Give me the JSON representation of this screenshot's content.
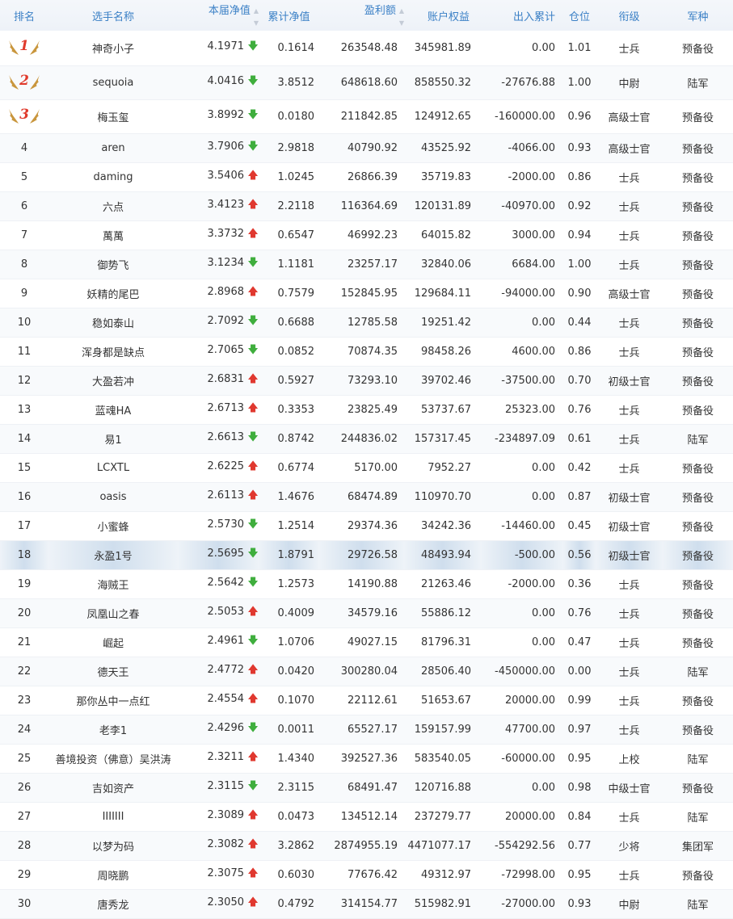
{
  "colors": {
    "header_text": "#3b80c6",
    "up": "#e0382f",
    "down": "#3fae3d",
    "medal_number": "#e03a2c",
    "medal_wing": "#c9963d"
  },
  "headers": {
    "rank": "排名",
    "name": "选手名称",
    "nav": "本届净值",
    "cum_nav": "累计净值",
    "profit": "盈利额",
    "equity": "账户权益",
    "flow": "出入累计",
    "position": "仓位",
    "title": "衔级",
    "army": "军种"
  },
  "icons": {
    "sort": "sort-icon",
    "up": "arrow-up-icon",
    "down": "arrow-down-icon",
    "medal": "winged-medal-icon"
  },
  "rows": [
    {
      "rank": "1",
      "medal": true,
      "name": "神奇小子",
      "nav": "4.1971",
      "trend": "down",
      "cum": "0.1614",
      "profit": "263548.48",
      "equity": "345981.89",
      "flow": "0.00",
      "pos": "1.01",
      "title": "士兵",
      "army": "预备役"
    },
    {
      "rank": "2",
      "medal": true,
      "name": "sequoia",
      "nav": "4.0416",
      "trend": "down",
      "cum": "3.8512",
      "profit": "648618.60",
      "equity": "858550.32",
      "flow": "-27676.88",
      "pos": "1.00",
      "title": "中尉",
      "army": "陆军"
    },
    {
      "rank": "3",
      "medal": true,
      "name": "梅玉玺",
      "nav": "3.8992",
      "trend": "down",
      "cum": "0.0180",
      "profit": "211842.85",
      "equity": "124912.65",
      "flow": "-160000.00",
      "pos": "0.96",
      "title": "高级士官",
      "army": "预备役"
    },
    {
      "rank": "4",
      "name": "aren",
      "nav": "3.7906",
      "trend": "down",
      "cum": "2.9818",
      "profit": "40790.92",
      "equity": "43525.92",
      "flow": "-4066.00",
      "pos": "0.93",
      "title": "高级士官",
      "army": "预备役"
    },
    {
      "rank": "5",
      "name": "daming",
      "nav": "3.5406",
      "trend": "up",
      "cum": "1.0245",
      "profit": "26866.39",
      "equity": "35719.83",
      "flow": "-2000.00",
      "pos": "0.86",
      "title": "士兵",
      "army": "预备役"
    },
    {
      "rank": "6",
      "name": "六点",
      "nav": "3.4123",
      "trend": "up",
      "cum": "2.2118",
      "profit": "116364.69",
      "equity": "120131.89",
      "flow": "-40970.00",
      "pos": "0.92",
      "title": "士兵",
      "army": "预备役"
    },
    {
      "rank": "7",
      "name": "萬萬",
      "nav": "3.3732",
      "trend": "up",
      "cum": "0.6547",
      "profit": "46992.23",
      "equity": "64015.82",
      "flow": "3000.00",
      "pos": "0.94",
      "title": "士兵",
      "army": "预备役"
    },
    {
      "rank": "8",
      "name": "御势飞",
      "nav": "3.1234",
      "trend": "down",
      "cum": "1.1181",
      "profit": "23257.17",
      "equity": "32840.06",
      "flow": "6684.00",
      "pos": "1.00",
      "title": "士兵",
      "army": "预备役"
    },
    {
      "rank": "9",
      "name": "妖精的尾巴",
      "nav": "2.8968",
      "trend": "up",
      "cum": "0.7579",
      "profit": "152845.95",
      "equity": "129684.11",
      "flow": "-94000.00",
      "pos": "0.90",
      "title": "高级士官",
      "army": "预备役"
    },
    {
      "rank": "10",
      "name": "稳如泰山",
      "nav": "2.7092",
      "trend": "down",
      "cum": "0.6688",
      "profit": "12785.58",
      "equity": "19251.42",
      "flow": "0.00",
      "pos": "0.44",
      "title": "士兵",
      "army": "预备役"
    },
    {
      "rank": "11",
      "name": "浑身都是缺点",
      "nav": "2.7065",
      "trend": "down",
      "cum": "0.0852",
      "profit": "70874.35",
      "equity": "98458.26",
      "flow": "4600.00",
      "pos": "0.86",
      "title": "士兵",
      "army": "预备役"
    },
    {
      "rank": "12",
      "name": "大盈若冲",
      "nav": "2.6831",
      "trend": "up",
      "cum": "0.5927",
      "profit": "73293.10",
      "equity": "39702.46",
      "flow": "-37500.00",
      "pos": "0.70",
      "title": "初级士官",
      "army": "预备役"
    },
    {
      "rank": "13",
      "name": "蓝魂HA",
      "nav": "2.6713",
      "trend": "up",
      "cum": "0.3353",
      "profit": "23825.49",
      "equity": "53737.67",
      "flow": "25323.00",
      "pos": "0.76",
      "title": "士兵",
      "army": "预备役"
    },
    {
      "rank": "14",
      "name": "易1",
      "nav": "2.6613",
      "trend": "down",
      "cum": "0.8742",
      "profit": "244836.02",
      "equity": "157317.45",
      "flow": "-234897.09",
      "pos": "0.61",
      "title": "士兵",
      "army": "陆军"
    },
    {
      "rank": "15",
      "name": "LCXTL",
      "nav": "2.6225",
      "trend": "up",
      "cum": "0.6774",
      "profit": "5170.00",
      "equity": "7952.27",
      "flow": "0.00",
      "pos": "0.42",
      "title": "士兵",
      "army": "预备役"
    },
    {
      "rank": "16",
      "name": "oasis",
      "nav": "2.6113",
      "trend": "up",
      "cum": "1.4676",
      "profit": "68474.89",
      "equity": "110970.70",
      "flow": "0.00",
      "pos": "0.87",
      "title": "初级士官",
      "army": "预备役"
    },
    {
      "rank": "17",
      "name": "小蜜蜂",
      "nav": "2.5730",
      "trend": "down",
      "cum": "1.2514",
      "profit": "29374.36",
      "equity": "34242.36",
      "flow": "-14460.00",
      "pos": "0.45",
      "title": "初级士官",
      "army": "预备役"
    },
    {
      "rank": "18",
      "name": "永盈1号",
      "nav": "2.5695",
      "trend": "down",
      "cum": "1.8791",
      "profit": "29726.58",
      "equity": "48493.94",
      "flow": "-500.00",
      "pos": "0.56",
      "title": "初级士官",
      "army": "预备役",
      "highlight": true
    },
    {
      "rank": "19",
      "name": "海贼王",
      "nav": "2.5642",
      "trend": "down",
      "cum": "1.2573",
      "profit": "14190.88",
      "equity": "21263.46",
      "flow": "-2000.00",
      "pos": "0.36",
      "title": "士兵",
      "army": "预备役"
    },
    {
      "rank": "20",
      "name": "凤凰山之春",
      "nav": "2.5053",
      "trend": "up",
      "cum": "0.4009",
      "profit": "34579.16",
      "equity": "55886.12",
      "flow": "0.00",
      "pos": "0.76",
      "title": "士兵",
      "army": "预备役"
    },
    {
      "rank": "21",
      "name": "崛起",
      "nav": "2.4961",
      "trend": "down",
      "cum": "1.0706",
      "profit": "49027.15",
      "equity": "81796.31",
      "flow": "0.00",
      "pos": "0.47",
      "title": "士兵",
      "army": "预备役"
    },
    {
      "rank": "22",
      "name": "德天王",
      "nav": "2.4772",
      "trend": "up",
      "cum": "0.0420",
      "profit": "300280.04",
      "equity": "28506.40",
      "flow": "-450000.00",
      "pos": "0.00",
      "title": "士兵",
      "army": "陆军"
    },
    {
      "rank": "23",
      "name": "那你丛中一点红",
      "nav": "2.4554",
      "trend": "up",
      "cum": "0.1070",
      "profit": "22112.61",
      "equity": "51653.67",
      "flow": "20000.00",
      "pos": "0.99",
      "title": "士兵",
      "army": "预备役"
    },
    {
      "rank": "24",
      "name": "老李1",
      "nav": "2.4296",
      "trend": "down",
      "cum": "0.0011",
      "profit": "65527.17",
      "equity": "159157.99",
      "flow": "47700.00",
      "pos": "0.97",
      "title": "士兵",
      "army": "预备役"
    },
    {
      "rank": "25",
      "name": "善境投资（佛意）吴洪涛",
      "nav": "2.3211",
      "trend": "up",
      "cum": "1.4340",
      "profit": "392527.36",
      "equity": "583540.05",
      "flow": "-60000.00",
      "pos": "0.95",
      "title": "上校",
      "army": "陆军"
    },
    {
      "rank": "26",
      "name": "吉如资产",
      "nav": "2.3115",
      "trend": "down",
      "cum": "2.3115",
      "profit": "68491.47",
      "equity": "120716.88",
      "flow": "0.00",
      "pos": "0.98",
      "title": "中级士官",
      "army": "预备役"
    },
    {
      "rank": "27",
      "name": "IIIIIII",
      "nav": "2.3089",
      "trend": "up",
      "cum": "0.0473",
      "profit": "134512.14",
      "equity": "237279.77",
      "flow": "20000.00",
      "pos": "0.84",
      "title": "士兵",
      "army": "陆军"
    },
    {
      "rank": "28",
      "name": "以梦为码",
      "nav": "2.3082",
      "trend": "up",
      "cum": "3.2862",
      "profit": "2874955.19",
      "equity": "4471077.17",
      "flow": "-554292.56",
      "pos": "0.77",
      "title": "少将",
      "army": "集团军"
    },
    {
      "rank": "29",
      "name": "周晓鹏",
      "nav": "2.3075",
      "trend": "up",
      "cum": "0.6030",
      "profit": "77676.42",
      "equity": "49312.97",
      "flow": "-72998.00",
      "pos": "0.95",
      "title": "士兵",
      "army": "预备役"
    },
    {
      "rank": "30",
      "name": "唐秀龙",
      "nav": "2.3050",
      "trend": "up",
      "cum": "0.4792",
      "profit": "314154.77",
      "equity": "515982.91",
      "flow": "-27000.00",
      "pos": "0.93",
      "title": "中尉",
      "army": "陆军"
    }
  ]
}
